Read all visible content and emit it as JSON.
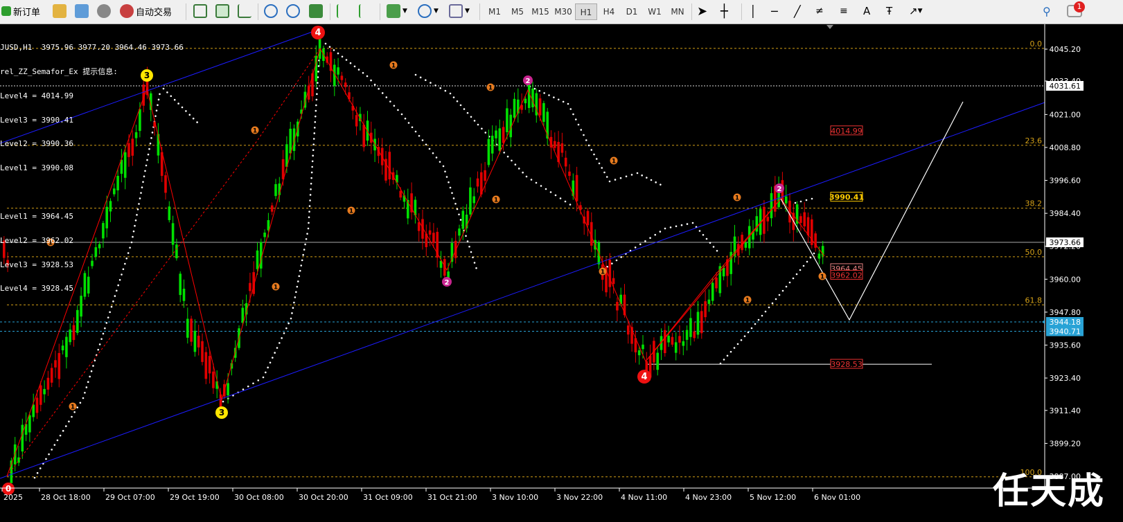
{
  "toolbar": {
    "new_order": "新订单",
    "auto_trading": "自动交易",
    "timeframes": [
      "M1",
      "M5",
      "M15",
      "M30",
      "H1",
      "H4",
      "D1",
      "W1",
      "MN"
    ],
    "active_timeframe": "H1",
    "notification_count": "1"
  },
  "chart_info": {
    "line1": "JUSD,H1  3975.96 3977.20 3964.46 3973.66",
    "line2": "rel_ZZ_Semafor_Ex 提示信息:",
    "levels_up": [
      "Level4 = 4014.99",
      "Level3 = 3990.41",
      "Level2 = 3990.36",
      "Level1 = 3990.08"
    ],
    "levels_down": [
      "Level1 = 3964.45",
      "Level2 = 3962.02",
      "Level3 = 3928.53",
      "Level4 = 3928.45"
    ]
  },
  "chart_data": {
    "type": "candlestick",
    "symbol": "JUSD",
    "timeframe": "H1",
    "ohlc": {
      "open": 3975.96,
      "high": 3977.2,
      "low": 3964.46,
      "close": 3973.66
    },
    "y_ticks": [
      "4045.20",
      "4033.40",
      "4021.00",
      "4008.80",
      "3996.60",
      "3984.40",
      "3972.20",
      "3960.00",
      "3947.80",
      "3935.60",
      "3923.40",
      "3911.40",
      "3899.20",
      "3887.00"
    ],
    "x_ticks": [
      "2025",
      "28 Oct 18:00",
      "29 Oct 07:00",
      "29 Oct 19:00",
      "30 Oct 08:00",
      "30 Oct 20:00",
      "31 Oct 09:00",
      "31 Oct 21:00",
      "3 Nov 10:00",
      "3 Nov 22:00",
      "4 Nov 11:00",
      "4 Nov 23:00",
      "5 Nov 12:00",
      "6 Nov 01:00"
    ],
    "price_tags": [
      {
        "text": "4031.61",
        "style": "white"
      },
      {
        "text": "3973.66",
        "style": "white"
      },
      {
        "text": "3944.18",
        "style": "blue"
      },
      {
        "text": "3940.71",
        "style": "blue"
      }
    ],
    "fib_labels": [
      "0.0",
      "23.6",
      "38.2",
      "50.0",
      "61.8",
      "100.0"
    ],
    "level_labels": [
      "4014.99",
      "3990.41",
      "3964.45",
      "3962.02",
      "3928.53"
    ],
    "semafor_labels": [
      "4",
      "3",
      "3",
      "4",
      "2",
      "2",
      "2",
      "1",
      "0"
    ],
    "colors": {
      "bull": "#00e000",
      "bear": "#e00000",
      "fib": "#d4a017",
      "channel": "#1c1cff",
      "zigzag": "#ff0000"
    }
  },
  "watermark": "任天成"
}
